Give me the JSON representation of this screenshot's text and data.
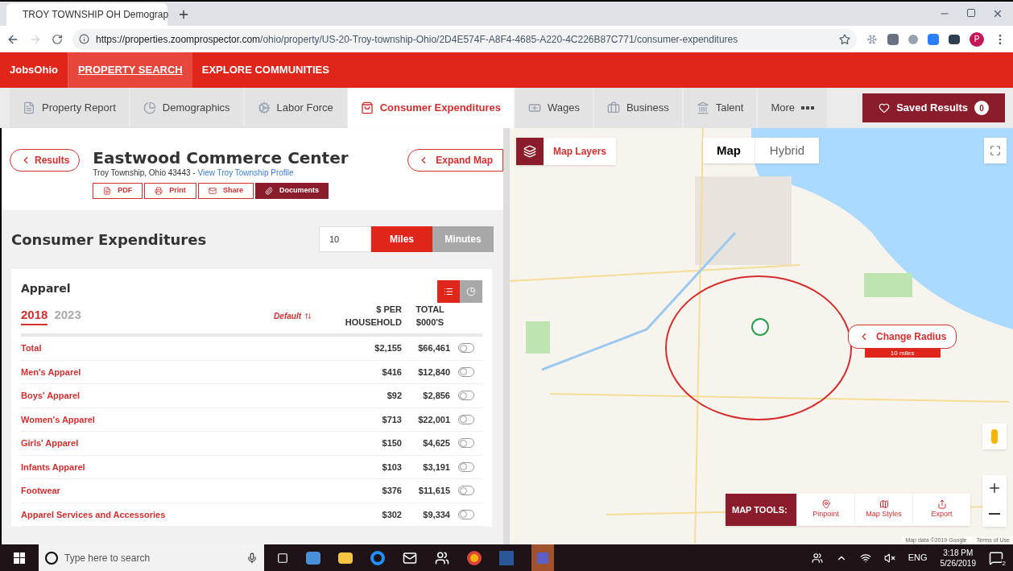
{
  "browser": {
    "tab_title": "TROY TOWNSHIP OH Demograp",
    "url_host": "https://properties.zoomprospector.com",
    "url_path": "/ohio/property/US-20-Troy-township-Ohio/2D4E574F-A8F4-4685-A220-4C226B87C771/consumer-expenditures",
    "profile_initial": "P"
  },
  "nav": {
    "brand": "JobsOhio",
    "items": [
      {
        "label": "PROPERTY SEARCH",
        "selected": true
      },
      {
        "label": "EXPLORE COMMUNITIES",
        "selected": false
      }
    ]
  },
  "tabs": [
    {
      "label": "Property Report",
      "kind": "doc",
      "selected": false
    },
    {
      "label": "Demographics",
      "kind": "pie",
      "selected": false
    },
    {
      "label": "Labor Force",
      "kind": "gears",
      "selected": false
    },
    {
      "label": "Consumer Expenditures",
      "kind": "bag",
      "selected": true
    },
    {
      "label": "Wages",
      "kind": "money",
      "selected": false
    },
    {
      "label": "Business",
      "kind": "briefcase",
      "selected": false
    },
    {
      "label": "Talent",
      "kind": "bank",
      "selected": false
    },
    {
      "label": "More",
      "kind": "more",
      "selected": false
    }
  ],
  "saved_results": {
    "label": "Saved Results",
    "count": "0"
  },
  "property": {
    "back": "Results",
    "name": "Eastwood Commerce Center",
    "address": "Troy Township, Ohio 43443 - ",
    "profile_link": "View Troy Township Profile",
    "expand_map": "Expand Map",
    "actions": [
      {
        "label": "PDF",
        "kind": "file",
        "filled": false
      },
      {
        "label": "Print",
        "kind": "print",
        "filled": false
      },
      {
        "label": "Share",
        "kind": "mail",
        "filled": false
      },
      {
        "label": "Documents",
        "kind": "clip",
        "filled": true
      }
    ]
  },
  "section": {
    "title": "Consumer Expenditures",
    "radius": "10",
    "units": [
      {
        "label": "Miles",
        "selected": true
      },
      {
        "label": "Minutes",
        "selected": false
      }
    ]
  },
  "card": {
    "title": "Apparel",
    "views": [
      {
        "kind": "list",
        "selected": true
      },
      {
        "kind": "pie",
        "selected": false
      }
    ],
    "years": [
      {
        "label": "2018",
        "selected": true
      },
      {
        "label": "2023",
        "selected": false
      }
    ],
    "sort": "Default",
    "columns": [
      "$ PER HOUSEHOLD",
      "TOTAL $000'S"
    ],
    "rows": [
      {
        "name": "Total",
        "per_household": "$2,155",
        "total": "$66,461",
        "on": false
      },
      {
        "name": "Men's Apparel",
        "per_household": "$416",
        "total": "$12,840",
        "on": false
      },
      {
        "name": "Boys' Apparel",
        "per_household": "$92",
        "total": "$2,856",
        "on": false
      },
      {
        "name": "Women's Apparel",
        "per_household": "$713",
        "total": "$22,001",
        "on": false
      },
      {
        "name": "Girls' Apparel",
        "per_household": "$150",
        "total": "$4,625",
        "on": false
      },
      {
        "name": "Infants Apparel",
        "per_household": "$103",
        "total": "$3,191",
        "on": false
      },
      {
        "name": "Footwear",
        "per_household": "$376",
        "total": "$11,615",
        "on": false
      },
      {
        "name": "Apparel Services and Accessories",
        "per_household": "$302",
        "total": "$9,334",
        "on": false
      }
    ]
  },
  "map": {
    "layers": "Map Layers",
    "types": [
      {
        "label": "Map",
        "selected": true
      },
      {
        "label": "Hybrid",
        "selected": false
      }
    ],
    "change_radius": {
      "label": "Change Radius",
      "reading": "10 miles"
    },
    "tools_title": "MAP TOOLS:",
    "tools": [
      {
        "label": "Pinpoint",
        "kind": "pin"
      },
      {
        "label": "Map Styles",
        "kind": "map"
      },
      {
        "label": "Export",
        "kind": "export"
      }
    ],
    "attribution": [
      "Map data ©2019 Google",
      "Terms of Use"
    ]
  },
  "taskbar": {
    "search_placeholder": "Type here to search",
    "language": "ENG",
    "time": "3:18 PM",
    "date": "5/26/2019",
    "notifications": "2"
  }
}
